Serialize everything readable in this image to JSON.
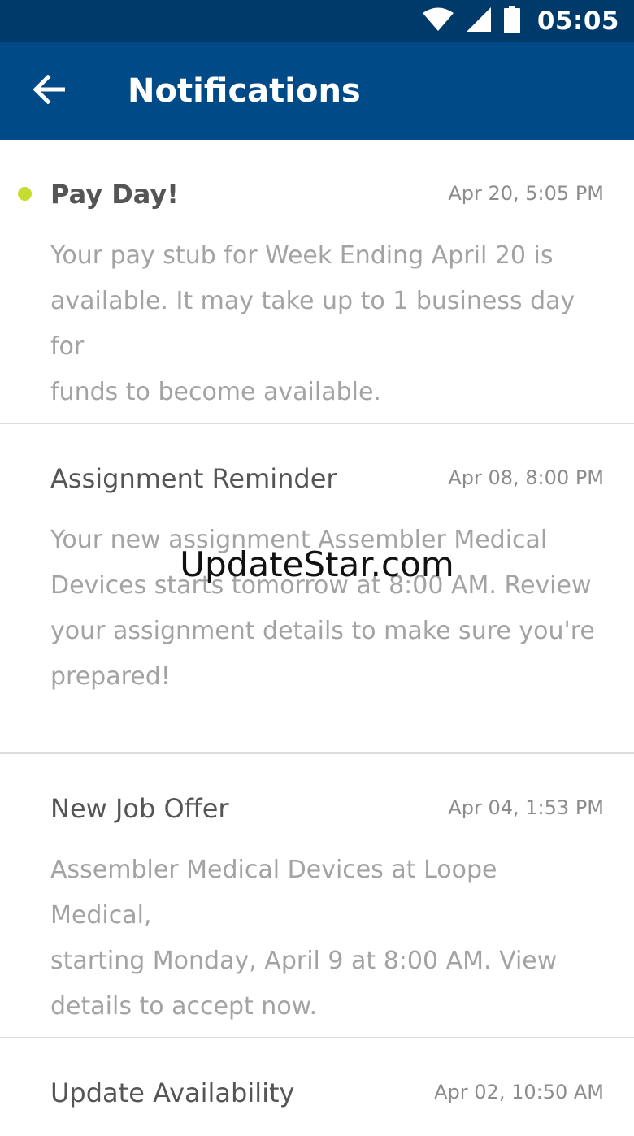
{
  "status_bar": {
    "time": "05:05",
    "icons": [
      "wifi-icon",
      "cell-signal-icon",
      "battery-icon"
    ]
  },
  "app_bar": {
    "title": "Notifications",
    "back_icon": "arrow-left-icon"
  },
  "notifications": [
    {
      "title": "Pay Day!",
      "time": "Apr 20, 5:05 PM",
      "body": "Your pay stub for Week Ending April 20 is\navailable. It may take up to 1 business day for\nfunds to become available.",
      "unread": true
    },
    {
      "title": "Assignment Reminder",
      "time": "Apr 08, 8:00 PM",
      "body": "Your new assignment Assembler Medical\nDevices starts tomorrow at 8:00 AM.  Review\nyour assignment details to make sure you're\nprepared!",
      "unread": false
    },
    {
      "title": "New Job Offer",
      "time": "Apr 04, 1:53 PM",
      "body": "Assembler Medical Devices at Loope Medical,\nstarting Monday, April 9 at 8:00 AM.  View\ndetails to accept now.",
      "unread": false
    },
    {
      "title": "Update Availability",
      "time": "Apr 02, 10:50 AM",
      "body": "",
      "unread": false
    }
  ],
  "watermark": "UpdateStar.com",
  "colors": {
    "status_bar": "#003a6b",
    "app_bar": "#004a87",
    "unread_dot": "#c6dc2e",
    "title_text": "#555555",
    "body_text": "#a3a3a3",
    "divider": "#dcdcdc"
  }
}
